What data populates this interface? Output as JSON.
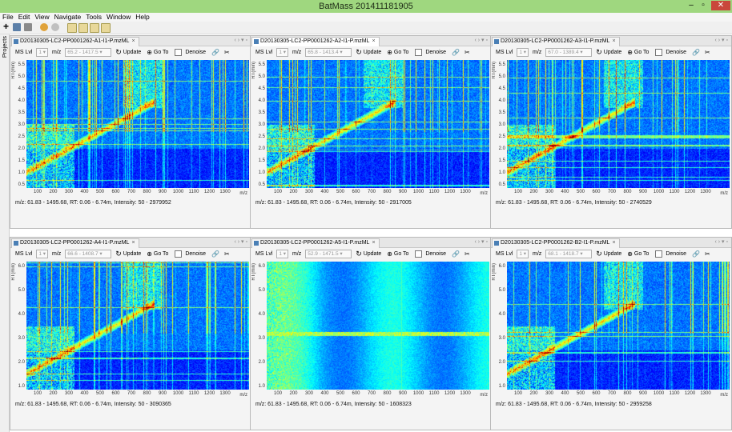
{
  "window": {
    "title": "BatMass 201411181905"
  },
  "menu": [
    "File",
    "Edit",
    "View",
    "Navigate",
    "Tools",
    "Window",
    "Help"
  ],
  "sidebar": {
    "label": "Projects"
  },
  "panel_controls": {
    "ms_lvl_label": "MS Lvl",
    "ms_lvl_value": "1",
    "mz_label": "m/z",
    "update": "Update",
    "goto": "Go To",
    "denoise": "Denoise"
  },
  "axes": {
    "y_unit": "RT(min)",
    "x_unit": "m/z",
    "y_ticks_full": [
      "5.5",
      "5.0",
      "4.5",
      "4.0",
      "3.5",
      "3.0",
      "2.5",
      "2.0",
      "1.5",
      "1.0",
      "0.5"
    ],
    "y_ticks_short": [
      "6.0",
      "5.0",
      "4.0",
      "3.0",
      "2.0",
      "1.0"
    ],
    "x_ticks": [
      "100",
      "200",
      "300",
      "400",
      "500",
      "600",
      "700",
      "800",
      "900",
      "1000",
      "1100",
      "1200",
      "1300"
    ]
  },
  "panels": [
    {
      "tab": "D20130305-LC2-PP0001262-A1-I1-P.mzML",
      "mz_range": "65.2 - 1417.5",
      "status": "m/z: 61.83 - 1495.68, RT: 0.06 - 6.74m, Intensity: 50 - 2979952",
      "ytype": "full",
      "style": "normal",
      "active": false
    },
    {
      "tab": "D20130305-LC2-PP0001262-A2-I1-P.mzML",
      "mz_range": "65.8 - 1413.4",
      "status": "m/z: 61.83 - 1495.68, RT: 0.06 - 6.74m, Intensity: 50 - 2917005",
      "ytype": "full",
      "style": "normal",
      "active": true
    },
    {
      "tab": "D20130305-LC2-PP0001262-A3-I1-P.mzML",
      "mz_range": "67.0 - 1389.4",
      "status": "m/z: 61.83 - 1495.68, RT: 0.06 - 6.74m, Intensity: 50 - 2740529",
      "ytype": "full",
      "style": "normal",
      "active": false
    },
    {
      "tab": "D20130305-LC2-PP0001262-A4-I1-P.mzML",
      "mz_range": "66.6 - 1408.7",
      "status": "m/z: 61.83 - 1495.68, RT: 0.06 - 6.74m, Intensity: 50 - 3090365",
      "ytype": "short",
      "style": "normal",
      "active": false
    },
    {
      "tab": "D20130305-LC2-PP0001262-A5-I1-P.mzML",
      "mz_range": "52.9 - 1471.5",
      "status": "m/z: 61.83 - 1495.68, RT: 0.06 - 6.74m, Intensity: 50 - 1608323",
      "ytype": "short",
      "style": "sparse",
      "active": false
    },
    {
      "tab": "D20130305-LC2-PP0001262-B2-I1-P.mzML",
      "mz_range": "68.1 - 1418.7",
      "status": "m/z: 61.83 - 1495.68, RT: 0.06 - 6.74m, Intensity: 50 - 2959258",
      "ytype": "short",
      "style": "normal",
      "active": false
    }
  ]
}
